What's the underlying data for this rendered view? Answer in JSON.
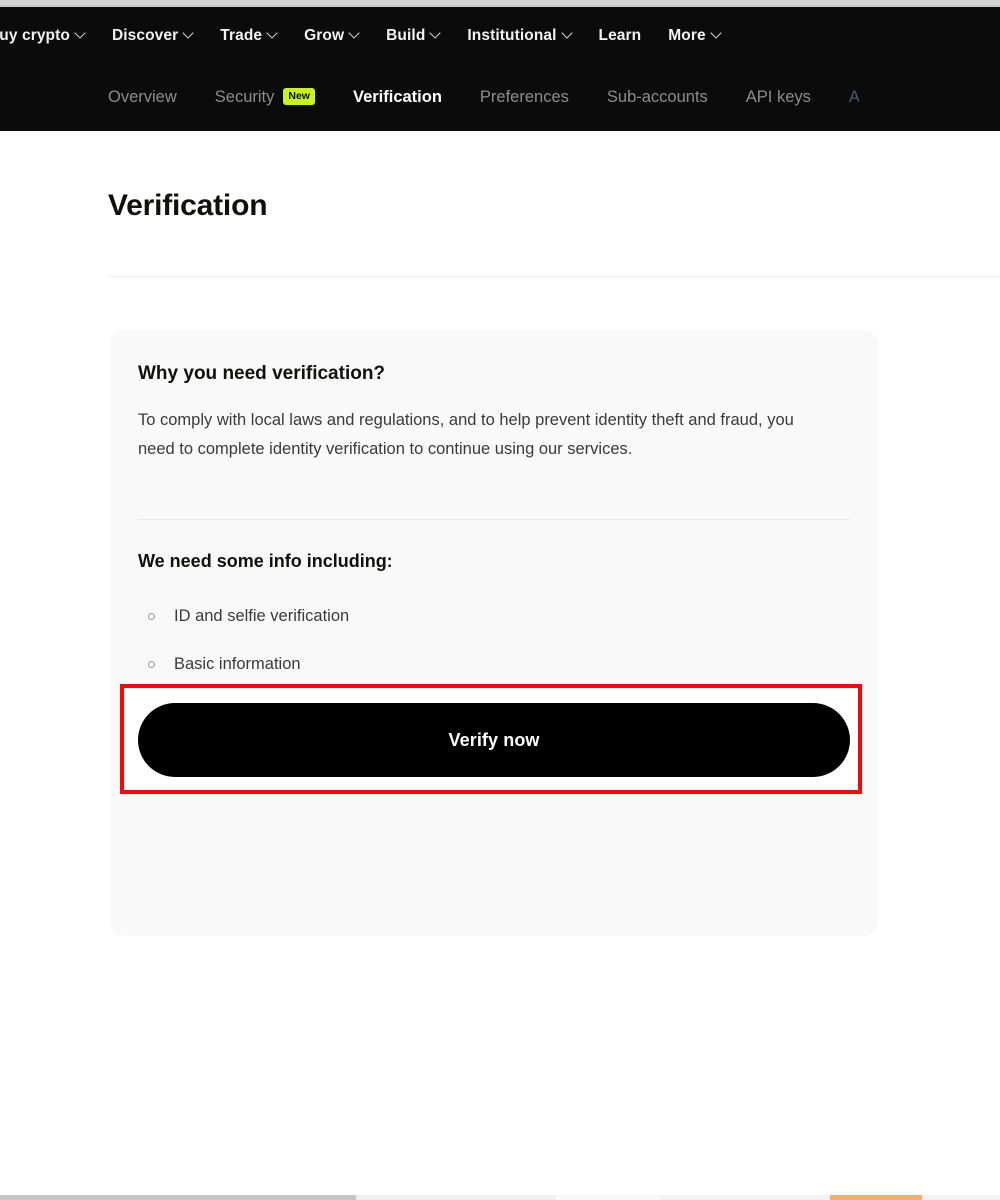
{
  "header": {
    "primary_nav": [
      {
        "label": "Buy crypto",
        "has_chevron": true,
        "icon": "chevron-down-icon",
        "truncated": true
      },
      {
        "label": "Discover",
        "has_chevron": true,
        "icon": "chevron-down-icon"
      },
      {
        "label": "Trade",
        "has_chevron": true,
        "icon": "chevron-down-icon"
      },
      {
        "label": "Grow",
        "has_chevron": true,
        "icon": "chevron-down-icon"
      },
      {
        "label": "Build",
        "has_chevron": true,
        "icon": "chevron-down-icon"
      },
      {
        "label": "Institutional",
        "has_chevron": true,
        "icon": "chevron-down-icon"
      },
      {
        "label": "Learn",
        "has_chevron": false
      },
      {
        "label": "More",
        "has_chevron": true,
        "icon": "chevron-down-icon"
      }
    ],
    "tabs": [
      {
        "label": "Overview",
        "active": false,
        "badge": null
      },
      {
        "label": "Security",
        "active": false,
        "badge": "New"
      },
      {
        "label": "Verification",
        "active": true,
        "badge": null
      },
      {
        "label": "Preferences",
        "active": false,
        "badge": null
      },
      {
        "label": "Sub-accounts",
        "active": false,
        "badge": null
      },
      {
        "label": "API keys",
        "active": false,
        "badge": null
      }
    ],
    "background_color": "#0b0b0b",
    "badge_color": "#c9f31d",
    "active_tab_color": "#ffffff",
    "inactive_tab_color": "#8c8c8c"
  },
  "main": {
    "page_title": "Verification",
    "card": {
      "heading": "Why you need verification?",
      "paragraph": "To comply with local laws and regulations, and to help prevent identity theft and fraud, you need to complete identity verification to continue using our services.",
      "subheading": "We need some info including:",
      "list_items": [
        "ID and selfie verification",
        "Basic information"
      ],
      "cta_label": "Verify now",
      "background_color": "#f9f9f9",
      "cta_background_color": "#000000",
      "cta_text_color": "#ffffff"
    }
  },
  "annotation": {
    "highlight_color": "#fb0505",
    "target": "Verify now"
  }
}
